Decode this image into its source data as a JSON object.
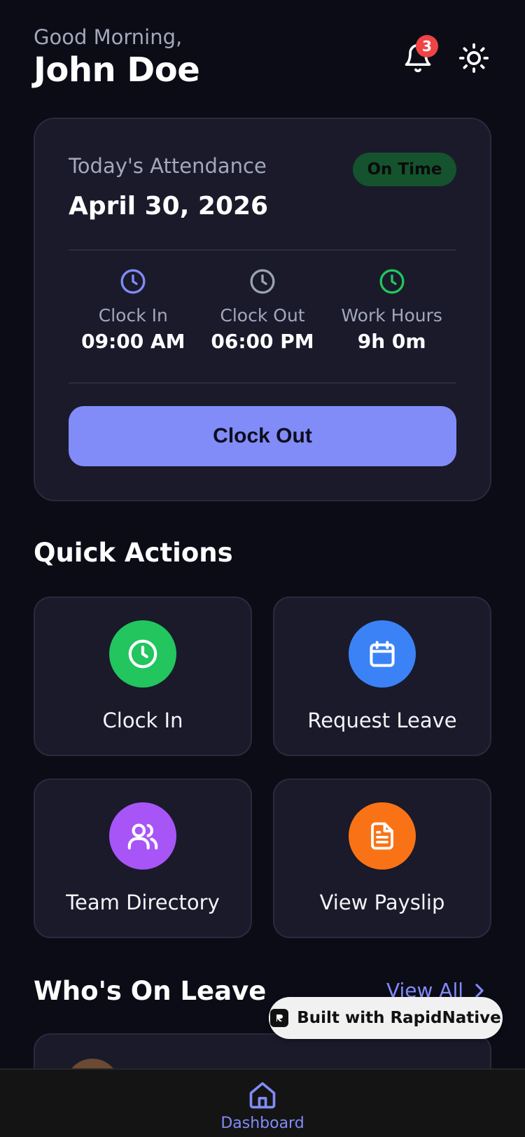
{
  "header": {
    "greeting": "Good Morning,",
    "username": "John Doe",
    "notification_count": "3"
  },
  "attendance": {
    "label": "Today's Attendance",
    "date": "April 30, 2026",
    "status": "On Time",
    "stats": [
      {
        "label": "Clock In",
        "value": "09:00 AM",
        "icon": "clock-icon",
        "color": "#818cf8"
      },
      {
        "label": "Clock Out",
        "value": "06:00 PM",
        "icon": "clock-icon",
        "color": "#9ca3af"
      },
      {
        "label": "Work Hours",
        "value": "9h 0m",
        "icon": "clock-icon",
        "color": "#22c55e"
      }
    ],
    "button_label": "Clock Out"
  },
  "quick_actions": {
    "title": "Quick Actions",
    "items": [
      {
        "label": "Clock In",
        "icon": "clock-icon",
        "color": "#22c55e"
      },
      {
        "label": "Request Leave",
        "icon": "calendar-icon",
        "color": "#3b82f6"
      },
      {
        "label": "Team Directory",
        "icon": "users-icon",
        "color": "#a855f7"
      },
      {
        "label": "View Payslip",
        "icon": "document-icon",
        "color": "#f97316"
      }
    ]
  },
  "leave": {
    "title": "Who's On Leave",
    "view_all": "View All"
  },
  "badge": {
    "label": "Built with RapidNative"
  },
  "tabbar": {
    "items": [
      {
        "label": "Dashboard",
        "icon": "home-icon",
        "active": true
      }
    ]
  },
  "colors": {
    "background": "#0c0c17",
    "card": "#1a1a2b",
    "accent": "#818cf8",
    "status_pill": "#14532d"
  }
}
